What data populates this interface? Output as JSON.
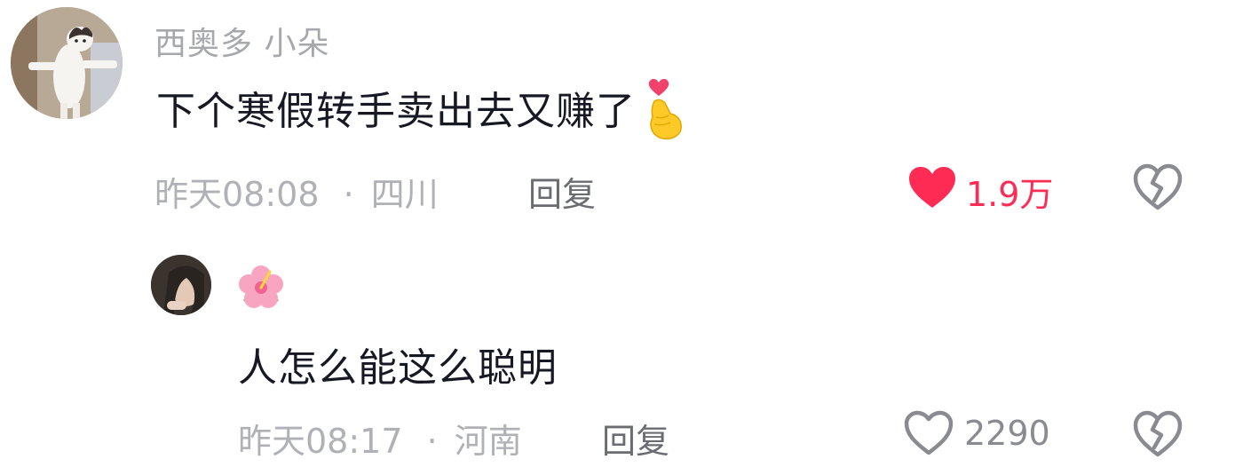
{
  "comments": [
    {
      "username": "西奥多 小朵",
      "text": "下个寒假转手卖出去又赚了",
      "text_emoji": "finger-heart",
      "time": "昨天08:08",
      "separator": "·",
      "location": "四川",
      "reply_label": "回复",
      "like_count": "1.9万",
      "liked": true,
      "like_color": "#fe2c55"
    },
    {
      "username_emoji": "hibiscus",
      "text": "人怎么能这么聪明",
      "time": "昨天08:17",
      "separator": "·",
      "location": "河南",
      "reply_label": "回复",
      "like_count": "2290",
      "liked": false
    }
  ]
}
